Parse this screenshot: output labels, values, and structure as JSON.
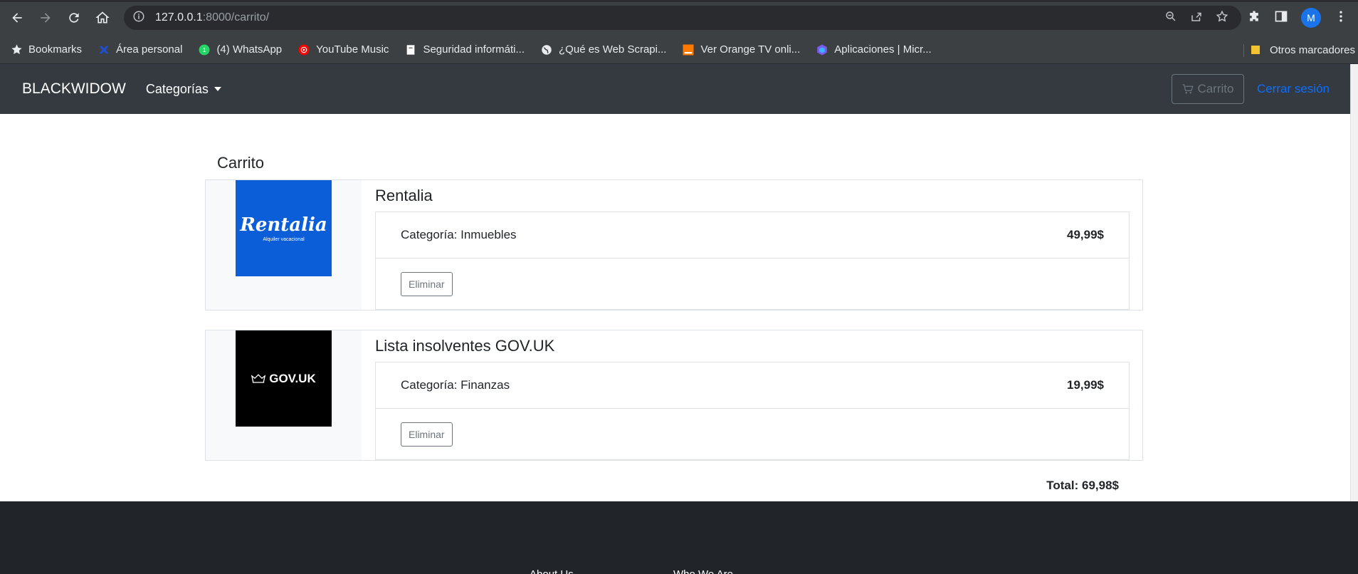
{
  "browser": {
    "url_host": "127.0.0.1",
    "url_path": ":8000/carrito/",
    "avatar_letter": "M"
  },
  "bookmarks": [
    {
      "label": "Bookmarks",
      "icon": "star-icon"
    },
    {
      "label": "Área personal",
      "icon": "puzzle-icon"
    },
    {
      "label": "(4) WhatsApp",
      "icon": "whatsapp-icon"
    },
    {
      "label": "YouTube Music",
      "icon": "youtube-music-icon"
    },
    {
      "label": "Seguridad informáti...",
      "icon": "page-icon"
    },
    {
      "label": "¿Qué es Web Scrapi...",
      "icon": "globe-icon"
    },
    {
      "label": "Ver Orange TV onli...",
      "icon": "orange-icon"
    },
    {
      "label": "Aplicaciones | Micr...",
      "icon": "microsoft-icon"
    }
  ],
  "other_bookmarks": "Otros marcadores",
  "navbar": {
    "brand": "BLACKWIDOW",
    "categories": "Categorías",
    "cart": "Carrito",
    "logout": "Cerrar sesión"
  },
  "cart": {
    "heading": "Carrito",
    "items": [
      {
        "title": "Rentalia",
        "logo_text": "Rentalia",
        "logo_sub": "Alquiler vacacional",
        "logo_bg": "#0b5ed7",
        "category": "Categoría: Inmuebles",
        "price": "49,99$",
        "remove": "Eliminar"
      },
      {
        "title": "Lista insolventes GOV.UK",
        "logo_text": "GOV.UK",
        "logo_sub": "",
        "logo_bg": "#000000",
        "category": "Categoría: Finanzas",
        "price": "19,99$",
        "remove": "Eliminar"
      }
    ],
    "total": "Total: 69,98$"
  },
  "footer": {
    "about": "About Us",
    "who": "Who We Are"
  }
}
